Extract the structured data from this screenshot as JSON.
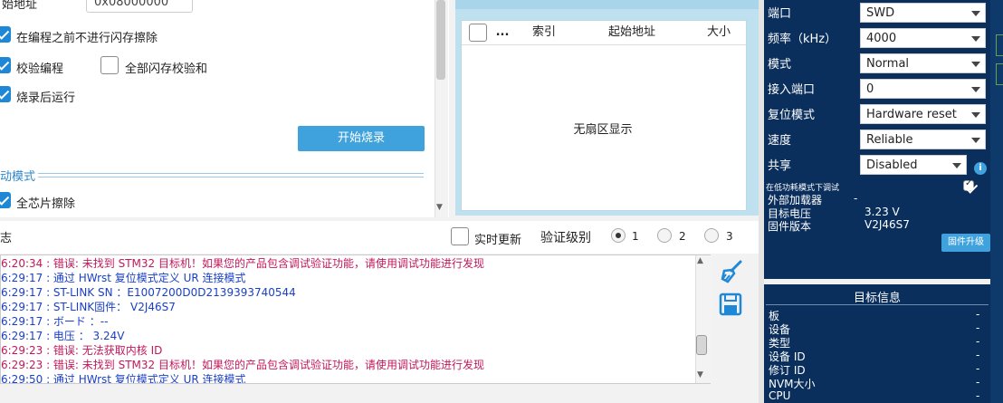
{
  "left": {
    "address_label": "始地址",
    "address_value": "0x08000000",
    "opt_no_erase": "在编程之前不进行闪存擦除",
    "opt_verify": "校验编程",
    "opt_full_checksum": "全部闪存校验和",
    "opt_run_after": "烧录后运行",
    "start_button": "开始烧录",
    "mode_title": "动模式",
    "opt_full_erase": "全芯片擦除"
  },
  "sector": {
    "columns": [
      "...",
      "索引",
      "起始地址",
      "大小"
    ],
    "empty_message": "无扇区显示"
  },
  "log": {
    "title": "志",
    "realtime_label": "实时更新",
    "verify_level_label": "验证级别",
    "levels": [
      "1",
      "2",
      "3"
    ],
    "selected_level": "1",
    "lines": [
      {
        "text": "6:20:34 : 错误: 未找到 STM32 目标机！如果您的产品包含调试验证功能，请使用调试功能进行发现",
        "color": "#c2185b"
      },
      {
        "text": "6:29:17 : 通过 HWrst 复位模式定义 UR 连接模式",
        "color": "#1a3fc8"
      },
      {
        "text": "6:29:17 : ST-LINK SN ：E1007200D0D2139393740544",
        "color": "#1a3fc8"
      },
      {
        "text": "6:29:17 : ST-LINK固件： V2J46S7",
        "color": "#1a3fc8"
      },
      {
        "text": "6:29:17 : ボード ：--",
        "color": "#1a3fc8"
      },
      {
        "text": "6:29:17 : 电压 ： 3.24V",
        "color": "#1a3fc8"
      },
      {
        "text": "6:29:23 : 错误: 无法获取内核 ID",
        "color": "#c2185b"
      },
      {
        "text": "6:29:23 : 错误: 未找到 STM32 目标机！如果您的产品包含调试验证功能，请使用调试功能进行发现",
        "color": "#c2185b"
      },
      {
        "text": "6:29:50 : 通过 HWrst 复位模式定义 UR 连接模式",
        "color": "#1a3fc8"
      }
    ]
  },
  "config": {
    "rows": [
      {
        "label": "端口",
        "value": "SWD"
      },
      {
        "label": "频率（kHz）",
        "value": "4000"
      },
      {
        "label": "模式",
        "value": "Normal"
      },
      {
        "label": "接入端口",
        "value": "0"
      },
      {
        "label": "复位模式",
        "value": "Hardware reset"
      },
      {
        "label": "速度",
        "value": "Reliable"
      },
      {
        "label": "共享",
        "value": "Disabled"
      }
    ],
    "low_power_debug": "在低功耗模式下调试",
    "ext_loader_label": "外部加载器",
    "ext_loader_value": "-",
    "target_voltage_label": "目标电压",
    "target_voltage_value": "3.23 V",
    "firmware_version_label": "固件版本",
    "firmware_version_value": "V2J46S7",
    "firmware_upgrade_button": "固件升级"
  },
  "target": {
    "title": "目标信息",
    "rows": [
      {
        "label": "板",
        "value": "-"
      },
      {
        "label": "设备",
        "value": "-"
      },
      {
        "label": "类型",
        "value": "-"
      },
      {
        "label": "设备 ID",
        "value": "-"
      },
      {
        "label": "修订 ID",
        "value": "-"
      },
      {
        "label": "NVM大小",
        "value": "-"
      },
      {
        "label": "CPU",
        "value": "-"
      }
    ]
  },
  "colors": {
    "accent": "#3fa2dc",
    "panel_navy": "#0a2f5c",
    "error_text": "#c2185b",
    "info_text": "#1a3fc8"
  }
}
